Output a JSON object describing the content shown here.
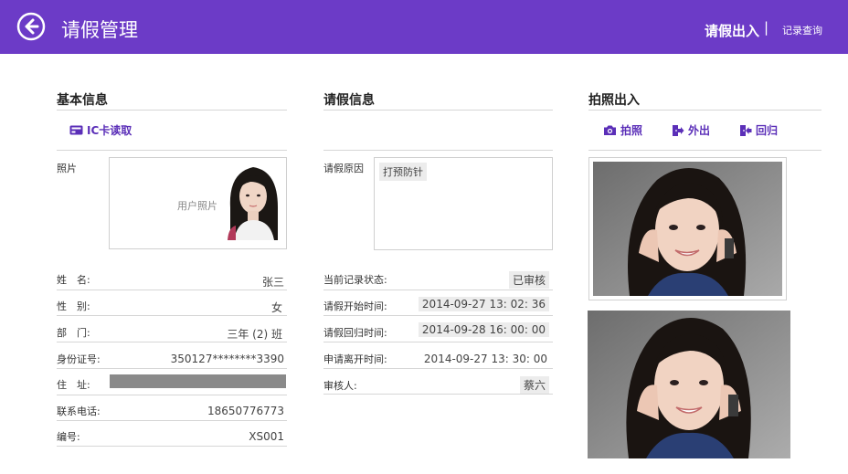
{
  "header": {
    "title": "请假管理",
    "nav_current": "请假出入",
    "nav_separator": "|",
    "nav_link": "记录查询"
  },
  "basic_info": {
    "section_title": "基本信息",
    "ic_card_button": "IC卡读取",
    "photo_label": "照片",
    "photo_placeholder": "用户照片",
    "fields": [
      {
        "label": "姓　名:",
        "value": "张三"
      },
      {
        "label": "性　别:",
        "value": "女"
      },
      {
        "label": "部　门:",
        "value": "三年 (2) 班"
      },
      {
        "label": "身份证号:",
        "value": "350127********3390"
      },
      {
        "label": "住　址:",
        "value": ""
      },
      {
        "label": "联系电话:",
        "value": "18650776773"
      },
      {
        "label": "编号:",
        "value": "XS001"
      }
    ]
  },
  "leave_info": {
    "section_title": "请假信息",
    "reason_label": "请假原因",
    "reason_value": "打预防针",
    "fields": [
      {
        "label": "当前记录状态:",
        "value": "已审核"
      },
      {
        "label": "请假开始时间:",
        "value": "2014-09-27 13: 02: 36"
      },
      {
        "label": "请假回归时间:",
        "value": "2014-09-28 16: 00: 00"
      },
      {
        "label": "申请离开时间:",
        "value": "2014-09-27 13: 30: 00"
      },
      {
        "label": "审核人:",
        "value": "蔡六"
      }
    ]
  },
  "photo_section": {
    "section_title": "拍照出入",
    "actions": {
      "photo": "拍照",
      "out": "外出",
      "return": "回归"
    }
  },
  "colors": {
    "accent": "#6c3bc7",
    "action_text": "#5b2fb8"
  }
}
